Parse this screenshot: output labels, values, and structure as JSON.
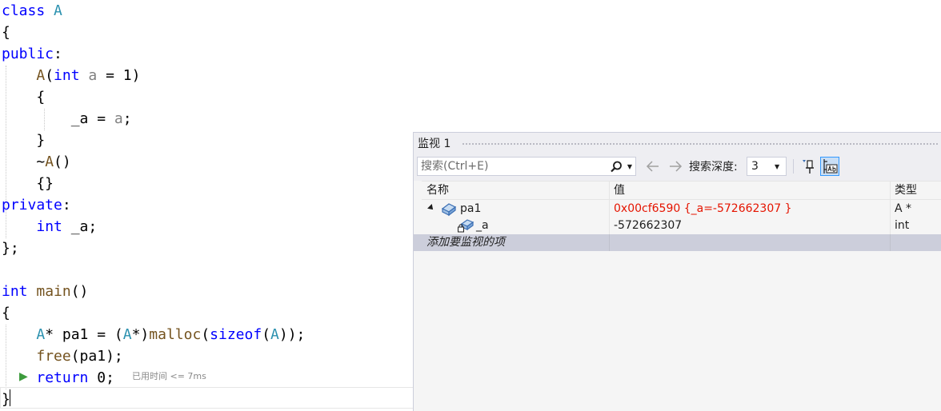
{
  "code": {
    "lines": [
      [
        {
          "t": "class",
          "c": "kw"
        },
        {
          "t": " "
        },
        {
          "t": "A",
          "c": "ty"
        }
      ],
      [
        {
          "t": "{"
        }
      ],
      [
        {
          "t": "public",
          "c": "kw"
        },
        {
          "t": ":"
        }
      ],
      [
        {
          "t": "    "
        },
        {
          "t": "A",
          "c": "fn"
        },
        {
          "t": "("
        },
        {
          "t": "int",
          "c": "kw"
        },
        {
          "t": " "
        },
        {
          "t": "a",
          "c": "par"
        },
        {
          "t": " = 1)"
        }
      ],
      [
        {
          "t": "    {"
        }
      ],
      [
        {
          "t": "        _a = "
        },
        {
          "t": "a",
          "c": "par"
        },
        {
          "t": ";"
        }
      ],
      [
        {
          "t": "    }"
        }
      ],
      [
        {
          "t": "    ~"
        },
        {
          "t": "A",
          "c": "fn"
        },
        {
          "t": "()"
        }
      ],
      [
        {
          "t": "    {}"
        }
      ],
      [
        {
          "t": "private",
          "c": "kw"
        },
        {
          "t": ":"
        }
      ],
      [
        {
          "t": "    "
        },
        {
          "t": "int",
          "c": "kw"
        },
        {
          "t": " _a;"
        }
      ],
      [
        {
          "t": "};"
        }
      ],
      [
        {
          "t": ""
        }
      ],
      [
        {
          "t": "int",
          "c": "kw"
        },
        {
          "t": " "
        },
        {
          "t": "main",
          "c": "fn"
        },
        {
          "t": "()"
        }
      ],
      [
        {
          "t": "{"
        }
      ],
      [
        {
          "t": "    "
        },
        {
          "t": "A",
          "c": "ty"
        },
        {
          "t": "* pa1 = ("
        },
        {
          "t": "A",
          "c": "ty"
        },
        {
          "t": "*)"
        },
        {
          "t": "malloc",
          "c": "fn"
        },
        {
          "t": "("
        },
        {
          "t": "sizeof",
          "c": "kw"
        },
        {
          "t": "("
        },
        {
          "t": "A",
          "c": "ty"
        },
        {
          "t": "));"
        }
      ],
      [
        {
          "t": "    "
        },
        {
          "t": "free",
          "c": "fn"
        },
        {
          "t": "(pa1);"
        }
      ],
      [
        {
          "t": "    "
        },
        {
          "t": "return",
          "c": "kw"
        },
        {
          "t": " 0;"
        }
      ],
      [
        {
          "t": "}"
        }
      ]
    ],
    "elapsed_hint": "已用时间 <= 7ms",
    "next_statement_glyph": "▶"
  },
  "watch": {
    "title": "监视 1",
    "search_placeholder": "搜索(Ctrl+E)",
    "search_dropdown": "▼",
    "depth_label": "搜索深度:",
    "depth_value": "3",
    "depth_dropdown": "▼",
    "columns": {
      "name": "名称",
      "value": "值",
      "type": "类型"
    },
    "rows": [
      {
        "name": "pa1",
        "value": "0x00cf6590 {_a=-572662307 }",
        "type": "A *",
        "expanded": true,
        "changed": true
      },
      {
        "name": "_a",
        "value": "-572662307",
        "type": "int",
        "child": true,
        "changed": false
      }
    ],
    "add_item_text": "添加要监视的项"
  },
  "colors": {
    "keyword": "#0000ff",
    "type": "#2b91af",
    "function": "#74531f",
    "parameter": "#808080",
    "changed_value": "#e51400",
    "selection": "#cccedb"
  }
}
